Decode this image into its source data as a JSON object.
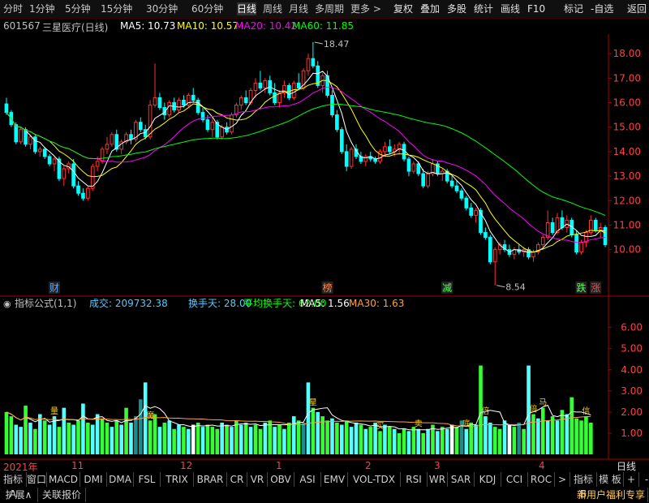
{
  "toolbar": {
    "left": [
      "分时",
      "1分钟",
      "5分钟",
      "15分钟",
      "30分钟",
      "60分钟",
      "日线",
      "周线",
      "月线",
      "多周期",
      "更多 >"
    ],
    "selected_index": 6,
    "right": [
      "复权",
      "叠加",
      "多股",
      "统计",
      "画线",
      "F10",
      "标记",
      "-自选",
      "返回"
    ]
  },
  "stock": {
    "code": "601567",
    "name": "三星医疗(日线)"
  },
  "ma_legend": [
    {
      "label": "MA5: 10.73",
      "color": "#ffffff"
    },
    {
      "label": "MA10: 10.57",
      "color": "#ffff00"
    },
    {
      "label": "MA20: 10.42",
      "color": "#ff00ff"
    },
    {
      "label": "MA60: 11.85",
      "color": "#00ff00"
    }
  ],
  "indicator_legend": {
    "name": "指标公式(1,1)",
    "items": [
      {
        "label": "成交: 209732.38",
        "color": "#55c8ff"
      },
      {
        "label": "换手天: 28.00",
        "color": "#55c8ff"
      },
      {
        "label": "平均换手天: 62.00",
        "color": "#00ff00"
      },
      {
        "label": "MA5: 1.56",
        "color": "#ffffff"
      },
      {
        "label": "MA30: 1.63",
        "color": "#ffa040"
      }
    ]
  },
  "markers": [
    {
      "text": "财",
      "x_index": 10,
      "color": "#55aaff"
    },
    {
      "text": "榜",
      "x_index": 67,
      "color": "#ff8844"
    },
    {
      "text": "减",
      "x_index": 92,
      "color": "#55ff55"
    },
    {
      "text": "跌",
      "x_index": 120,
      "color": "#55ff55"
    },
    {
      "text": "涨",
      "x_index": 123,
      "color": "#ff4444"
    }
  ],
  "vol_labels": [
    "量",
    "魔",
    "星",
    "买",
    "卖",
    "底",
    "留",
    "倍",
    "马",
    "信"
  ],
  "dates": [
    {
      "text": "2021年",
      "x": 4
    },
    {
      "text": "11",
      "x": 88
    },
    {
      "text": "12",
      "x": 222
    },
    {
      "text": "1",
      "x": 340
    },
    {
      "text": "2",
      "x": 450
    },
    {
      "text": "3",
      "x": 535
    },
    {
      "text": "4",
      "x": 664
    }
  ],
  "date_right": "日线",
  "tabs_row1": [
    "指标A",
    "窗口",
    "MACD",
    "DMI",
    "DMA",
    "FSL",
    "TRIX",
    "BRAR",
    "CR",
    "VR",
    "OBV",
    "ASI",
    "EMV",
    "VOL-TDX",
    "RSI",
    "WR",
    "SAR",
    "KDJ",
    "CCI",
    "ROC",
    ">",
    "指标B",
    "模 板",
    "+",
    "-"
  ],
  "tabs_row2": [
    "扩展∧",
    "关联报价"
  ],
  "tabs_row2_right": "新用户福利专享",
  "chart_data": [
    {
      "type": "candlestick",
      "title": "三星医疗(日线)",
      "ylim": [
        8.2,
        18.8
      ],
      "yticks": [
        10,
        11,
        12,
        13,
        14,
        15,
        16,
        17,
        18
      ],
      "annotations": [
        {
          "text": "18.47",
          "value": 18.47
        },
        {
          "text": "8.54",
          "value": 8.54
        }
      ],
      "colors": {
        "up": "#ff3030",
        "down": "#00ffff",
        "ma5": "#ffffff",
        "ma10": "#ffff00",
        "ma20": "#ff00ff",
        "ma60": "#00ff00"
      },
      "ohlc": [
        [
          15.95,
          16.2,
          15.5,
          15.6
        ],
        [
          15.6,
          15.7,
          15.0,
          15.1
        ],
        [
          15.1,
          15.2,
          14.3,
          14.4
        ],
        [
          14.4,
          15.0,
          14.3,
          14.9
        ],
        [
          14.9,
          15.0,
          14.2,
          14.3
        ],
        [
          14.3,
          14.7,
          14.1,
          14.6
        ],
        [
          14.6,
          14.7,
          13.9,
          14.0
        ],
        [
          14.0,
          14.2,
          13.8,
          14.1
        ],
        [
          14.1,
          14.2,
          13.7,
          13.8
        ],
        [
          13.8,
          13.9,
          13.4,
          13.5
        ],
        [
          13.5,
          13.8,
          13.2,
          13.7
        ],
        [
          13.7,
          13.8,
          12.8,
          12.9
        ],
        [
          12.9,
          13.4,
          12.6,
          13.3
        ],
        [
          13.3,
          13.6,
          13.1,
          13.5
        ],
        [
          13.5,
          13.7,
          12.5,
          12.6
        ],
        [
          12.6,
          12.8,
          12.2,
          12.3
        ],
        [
          12.3,
          12.5,
          12.0,
          12.1
        ],
        [
          12.1,
          12.6,
          12.0,
          12.5
        ],
        [
          12.5,
          13.5,
          12.4,
          13.4
        ],
        [
          13.4,
          13.8,
          13.2,
          13.6
        ],
        [
          13.6,
          14.2,
          13.5,
          14.1
        ],
        [
          14.1,
          14.6,
          13.9,
          14.3
        ],
        [
          14.3,
          14.8,
          14.2,
          14.7
        ],
        [
          14.7,
          14.9,
          14.0,
          14.1
        ],
        [
          14.1,
          14.5,
          13.9,
          14.4
        ],
        [
          14.4,
          14.8,
          14.3,
          14.7
        ],
        [
          14.7,
          14.9,
          14.3,
          14.5
        ],
        [
          14.5,
          15.3,
          14.4,
          15.2
        ],
        [
          15.2,
          15.4,
          14.8,
          14.9
        ],
        [
          14.9,
          15.1,
          14.5,
          14.6
        ],
        [
          14.6,
          16.1,
          14.5,
          15.9
        ],
        [
          15.9,
          17.6,
          15.8,
          16.2
        ],
        [
          16.2,
          16.4,
          15.7,
          15.8
        ],
        [
          15.8,
          16.0,
          15.3,
          15.5
        ],
        [
          15.5,
          16.1,
          15.4,
          16.0
        ],
        [
          16.0,
          16.2,
          15.6,
          15.7
        ],
        [
          15.7,
          16.2,
          15.6,
          16.1
        ],
        [
          16.1,
          16.3,
          15.8,
          15.9
        ],
        [
          15.9,
          16.4,
          15.8,
          16.3
        ],
        [
          16.3,
          16.6,
          16.0,
          16.1
        ],
        [
          16.1,
          16.2,
          15.5,
          15.6
        ],
        [
          15.6,
          15.8,
          15.2,
          15.3
        ],
        [
          15.3,
          15.5,
          14.8,
          14.9
        ],
        [
          14.9,
          15.4,
          14.6,
          15.2
        ],
        [
          15.2,
          15.3,
          14.5,
          14.6
        ],
        [
          14.6,
          15.1,
          14.5,
          15.0
        ],
        [
          15.0,
          15.2,
          14.7,
          14.8
        ],
        [
          14.8,
          15.6,
          14.7,
          15.5
        ],
        [
          15.5,
          16.0,
          15.4,
          15.9
        ],
        [
          15.9,
          16.3,
          15.7,
          16.2
        ],
        [
          16.2,
          16.5,
          15.9,
          16.0
        ],
        [
          16.0,
          16.6,
          15.9,
          16.5
        ],
        [
          16.5,
          17.0,
          16.2,
          16.8
        ],
        [
          16.8,
          17.3,
          16.5,
          16.6
        ],
        [
          16.6,
          17.0,
          16.4,
          16.9
        ],
        [
          16.9,
          17.1,
          16.3,
          16.4
        ],
        [
          16.4,
          16.8,
          15.9,
          16.0
        ],
        [
          16.0,
          16.5,
          15.8,
          16.4
        ],
        [
          16.4,
          16.9,
          16.2,
          16.7
        ],
        [
          16.7,
          16.8,
          16.1,
          16.2
        ],
        [
          16.2,
          16.9,
          16.1,
          16.8
        ],
        [
          16.8,
          17.2,
          16.5,
          16.6
        ],
        [
          16.6,
          17.4,
          16.5,
          17.3
        ],
        [
          17.3,
          18.0,
          17.1,
          17.8
        ],
        [
          17.8,
          18.47,
          17.4,
          17.5
        ],
        [
          17.5,
          17.7,
          16.6,
          16.7
        ],
        [
          16.7,
          17.2,
          16.4,
          17.1
        ],
        [
          17.1,
          17.3,
          16.2,
          16.3
        ],
        [
          16.3,
          16.5,
          15.4,
          15.5
        ],
        [
          15.5,
          15.7,
          14.8,
          14.9
        ],
        [
          14.9,
          15.0,
          13.9,
          14.0
        ],
        [
          14.0,
          14.3,
          13.2,
          13.4
        ],
        [
          13.4,
          14.2,
          13.3,
          14.1
        ],
        [
          14.1,
          14.3,
          13.7,
          13.8
        ],
        [
          13.8,
          14.0,
          13.5,
          13.6
        ],
        [
          13.6,
          13.9,
          13.4,
          13.8
        ],
        [
          13.8,
          14.0,
          13.6,
          13.7
        ],
        [
          13.7,
          13.8,
          13.5,
          13.6
        ],
        [
          13.6,
          14.1,
          13.5,
          14.0
        ],
        [
          14.0,
          14.4,
          13.8,
          14.2
        ],
        [
          14.2,
          14.5,
          13.9,
          14.0
        ],
        [
          14.0,
          14.3,
          13.8,
          14.1
        ],
        [
          14.1,
          14.4,
          13.9,
          14.3
        ],
        [
          14.3,
          14.4,
          13.6,
          13.7
        ],
        [
          13.7,
          13.8,
          13.0,
          13.2
        ],
        [
          13.2,
          13.6,
          13.1,
          13.5
        ],
        [
          13.5,
          13.6,
          13.0,
          13.1
        ],
        [
          13.1,
          13.3,
          12.5,
          12.6
        ],
        [
          12.6,
          13.2,
          12.5,
          13.1
        ],
        [
          13.1,
          13.7,
          13.0,
          13.5
        ],
        [
          13.5,
          13.6,
          13.0,
          13.1
        ],
        [
          13.1,
          13.3,
          12.8,
          13.2
        ],
        [
          13.2,
          13.3,
          12.7,
          12.8
        ],
        [
          12.8,
          13.0,
          12.5,
          12.6
        ],
        [
          12.6,
          12.8,
          12.3,
          12.4
        ],
        [
          12.4,
          12.5,
          12.0,
          12.1
        ],
        [
          12.1,
          12.2,
          11.6,
          11.7
        ],
        [
          11.7,
          11.9,
          11.3,
          11.4
        ],
        [
          11.4,
          11.7,
          11.1,
          11.6
        ],
        [
          11.6,
          11.7,
          10.6,
          10.7
        ],
        [
          10.7,
          10.9,
          10.4,
          10.5
        ],
        [
          10.5,
          10.6,
          9.4,
          9.5
        ],
        [
          9.5,
          10.1,
          8.54,
          10.0
        ],
        [
          10.0,
          10.3,
          9.8,
          10.2
        ],
        [
          10.2,
          10.4,
          9.9,
          10.0
        ],
        [
          10.0,
          10.2,
          9.7,
          9.8
        ],
        [
          9.8,
          10.1,
          9.6,
          10.0
        ],
        [
          10.0,
          10.2,
          9.8,
          9.9
        ],
        [
          9.9,
          10.1,
          9.7,
          10.0
        ],
        [
          10.0,
          10.1,
          9.6,
          9.7
        ],
        [
          9.7,
          10.0,
          9.5,
          9.9
        ],
        [
          9.9,
          10.3,
          9.8,
          10.2
        ],
        [
          10.2,
          10.6,
          10.1,
          10.5
        ],
        [
          10.5,
          11.6,
          10.4,
          11.1
        ],
        [
          11.1,
          11.3,
          10.6,
          10.7
        ],
        [
          10.7,
          11.5,
          10.6,
          11.3
        ],
        [
          11.3,
          11.6,
          10.8,
          10.9
        ],
        [
          10.9,
          11.4,
          10.7,
          11.2
        ],
        [
          11.2,
          11.3,
          10.5,
          10.6
        ],
        [
          10.6,
          10.8,
          9.8,
          9.9
        ],
        [
          9.9,
          10.4,
          9.8,
          10.3
        ],
        [
          10.3,
          10.8,
          10.1,
          10.7
        ],
        [
          10.7,
          11.4,
          10.6,
          11.2
        ],
        [
          11.2,
          11.3,
          10.7,
          10.8
        ],
        [
          10.8,
          11.1,
          10.5,
          10.9
        ],
        [
          10.9,
          11.0,
          10.1,
          10.2
        ]
      ]
    },
    {
      "type": "bar",
      "title": "指标公式(1,1)",
      "ylim": [
        0,
        6.6
      ],
      "yticks": [
        1.0,
        2.0,
        3.0,
        4.0,
        5.0,
        6.0
      ],
      "line_colors": {
        "ma5": "#ffffff",
        "ma30": "#ffa040"
      },
      "bar_palette": {
        "g": "#33ff33",
        "c": "#55ffff",
        "w": "#ffffff",
        "t": "#1a8c8c"
      },
      "values": [
        2.0,
        1.8,
        1.4,
        1.3,
        2.3,
        1.5,
        1.2,
        1.9,
        1.6,
        1.4,
        1.8,
        1.3,
        2.2,
        1.5,
        1.4,
        1.6,
        2.4,
        1.5,
        1.4,
        1.9,
        1.7,
        1.5,
        1.3,
        1.6,
        1.4,
        2.2,
        1.5,
        1.8,
        2.6,
        3.4,
        1.6,
        1.9,
        1.3,
        1.5,
        1.6,
        1.2,
        1.4,
        1.3,
        1.2,
        1.4,
        1.5,
        1.3,
        1.4,
        1.3,
        1.2,
        1.5,
        1.4,
        1.3,
        1.6,
        1.4,
        1.5,
        1.3,
        1.4,
        1.2,
        1.5,
        1.6,
        1.3,
        1.4,
        1.2,
        1.5,
        1.8,
        1.6,
        1.5,
        3.4,
        2.2,
        2.0,
        1.8,
        1.6,
        1.7,
        1.5,
        1.4,
        1.6,
        1.3,
        1.5,
        1.4,
        1.2,
        1.3,
        1.5,
        1.1,
        1.4,
        1.3,
        1.2,
        1.0,
        1.2,
        1.1,
        1.3,
        1.2,
        1.0,
        1.2,
        1.4,
        1.1,
        1.3,
        1.2,
        1.4,
        1.3,
        1.6,
        1.2,
        1.5,
        1.4,
        4.2,
        1.8,
        1.5,
        1.3,
        1.2,
        1.6,
        1.4,
        1.3,
        1.5,
        1.2,
        4.2,
        1.9,
        1.7,
        2.2,
        1.6,
        1.8,
        1.6,
        2.1,
        1.9,
        2.7,
        1.7,
        1.6,
        1.8,
        1.5
      ],
      "colors": "ggccgcgcgccgcgcgcgccggcgcgcttcggcgcgcgcwgcgggcgcgcgcggcgcgcgcgtcgcggcgcgccgcgcgcgcggcgcgcgcgcwgtcgcgccggcwgtgcgcgcgcgcg"
    }
  ]
}
